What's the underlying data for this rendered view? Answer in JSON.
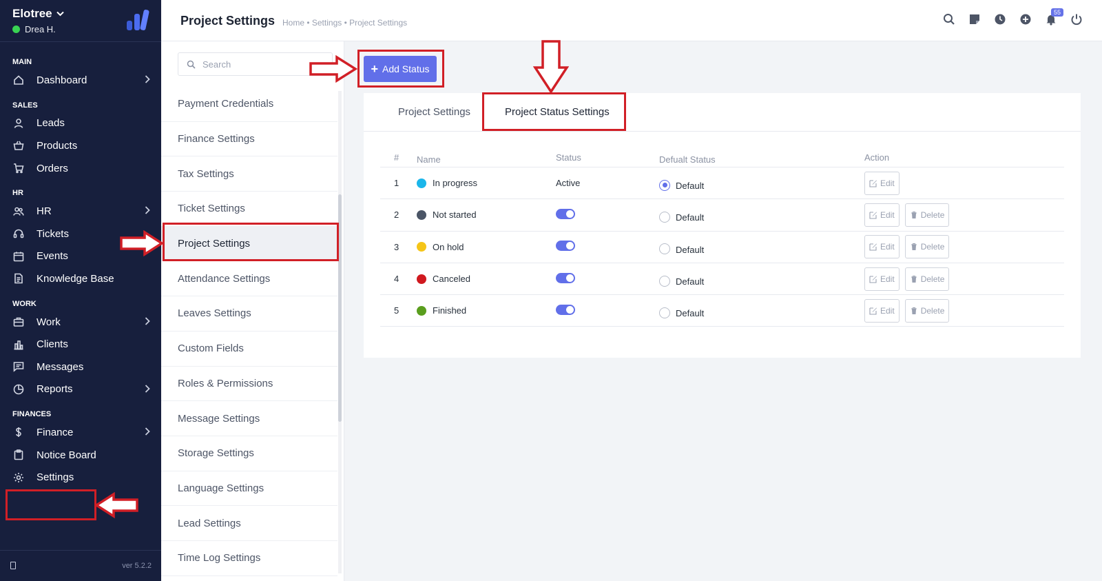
{
  "sidebar": {
    "brand": "Elotree",
    "user": "Drea H.",
    "version": "ver 5.2.2",
    "sections": [
      {
        "title": "MAIN",
        "items": [
          {
            "label": "Dashboard",
            "icon": "home-icon",
            "arrow": true
          }
        ]
      },
      {
        "title": "SALES",
        "items": [
          {
            "label": "Leads",
            "icon": "user-icon",
            "arrow": false
          },
          {
            "label": "Products",
            "icon": "basket-icon",
            "arrow": false
          },
          {
            "label": "Orders",
            "icon": "cart-icon",
            "arrow": false
          }
        ]
      },
      {
        "title": "HR",
        "items": [
          {
            "label": "HR",
            "icon": "people-icon",
            "arrow": true
          },
          {
            "label": "Tickets",
            "icon": "headset-icon",
            "arrow": false
          },
          {
            "label": "Events",
            "icon": "calendar-icon",
            "arrow": false
          },
          {
            "label": "Knowledge Base",
            "icon": "document-icon",
            "arrow": false
          }
        ]
      },
      {
        "title": "WORK",
        "items": [
          {
            "label": "Work",
            "icon": "briefcase-icon",
            "arrow": true
          },
          {
            "label": "Clients",
            "icon": "building-icon",
            "arrow": false
          },
          {
            "label": "Messages",
            "icon": "chat-icon",
            "arrow": false
          },
          {
            "label": "Reports",
            "icon": "pie-chart-icon",
            "arrow": true
          }
        ]
      },
      {
        "title": "FINANCES",
        "items": [
          {
            "label": "Finance",
            "icon": "dollar-icon",
            "arrow": true
          },
          {
            "label": "Notice Board",
            "icon": "clipboard-icon",
            "arrow": false
          },
          {
            "label": "Settings",
            "icon": "gear-icon",
            "arrow": false
          }
        ]
      }
    ]
  },
  "header": {
    "title": "Project Settings",
    "breadcrumb": "Home • Settings • Project Settings",
    "notification_count": "55"
  },
  "settings_menu": {
    "search_placeholder": "Search",
    "items": [
      "Payment Credentials",
      "Finance Settings",
      "Tax Settings",
      "Ticket Settings",
      "Project Settings",
      "Attendance Settings",
      "Leaves Settings",
      "Custom Fields",
      "Roles & Permissions",
      "Message Settings",
      "Storage Settings",
      "Language Settings",
      "Lead Settings",
      "Time Log Settings"
    ],
    "active_index": 4
  },
  "content": {
    "add_button": "Add Status",
    "tabs": [
      "Project Settings",
      "Project Status Settings"
    ],
    "active_tab": 1,
    "table": {
      "headers": [
        "#",
        "Name",
        "Status",
        "Defualt Status",
        "Action"
      ],
      "rows": [
        {
          "num": "1",
          "name": "In progress",
          "color": "#1bb6ea",
          "status": "Active",
          "is_default": true
        },
        {
          "num": "2",
          "name": "Not started",
          "color": "#4b5566",
          "status": "toggle-on",
          "is_default": false
        },
        {
          "num": "3",
          "name": "On hold",
          "color": "#f5c518",
          "status": "toggle-on",
          "is_default": false
        },
        {
          "num": "4",
          "name": "Canceled",
          "color": "#d0191f",
          "status": "toggle-on",
          "is_default": false
        },
        {
          "num": "5",
          "name": "Finished",
          "color": "#5a9e1e",
          "status": "toggle-on",
          "is_default": false
        }
      ],
      "default_label": "Default",
      "edit_label": "Edit",
      "delete_label": "Delete"
    }
  },
  "colors": {
    "sidebar_bg": "#171f3d",
    "accent": "#616fe9",
    "annotation_red": "#d11f26"
  }
}
